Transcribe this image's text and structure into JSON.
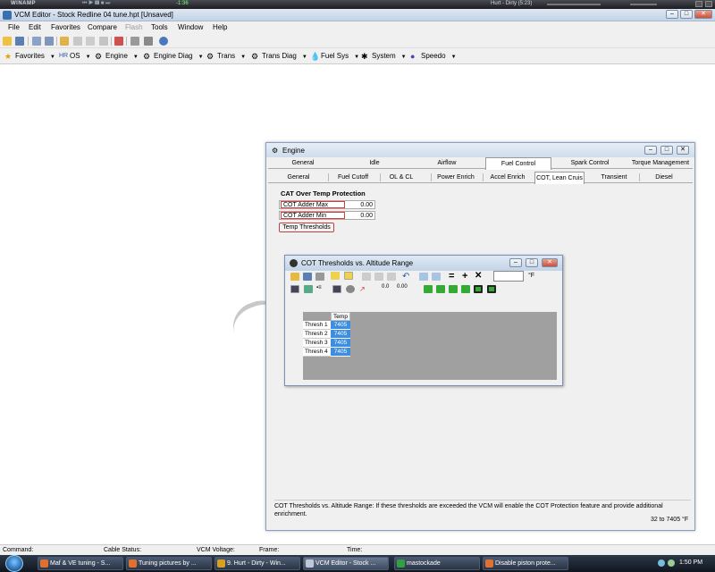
{
  "winamp": {
    "logo": "WINAMP",
    "time": "-1:36",
    "track": "Hurt - Dirty (5:23)"
  },
  "app": {
    "title": "VCM Editor - Stock Redline 04 tune.hpt   [Unsaved]"
  },
  "menu": {
    "items": [
      "File",
      "Edit",
      "Favorites",
      "Compare",
      "Flash",
      "Tools",
      "Window",
      "Help"
    ]
  },
  "toolbar2": {
    "items": [
      "Favorites",
      "OS",
      "Engine",
      "Engine Diag",
      "Trans",
      "Trans Diag",
      "Fuel Sys",
      "System",
      "Speedo"
    ]
  },
  "engine": {
    "title": "Engine",
    "tabs1": [
      "General",
      "Idle",
      "Airflow",
      "Fuel Control",
      "Spark Control",
      "Torque Management"
    ],
    "tabs2": [
      "General",
      "Fuel Cutoff",
      "OL & CL",
      "Power Enrich",
      "Accel Enrich",
      "COT, Lean Cruis",
      "Transient",
      "Diesel"
    ],
    "section_title": "CAT Over Temp Protection",
    "params": [
      {
        "label": "COT Adder Max",
        "value": "0.00"
      },
      {
        "label": "COT Adder Min",
        "value": "0.00"
      }
    ],
    "temp_button": "Temp Thresholds",
    "description": "COT Thresholds vs. Altitude Range: If these thresholds are exceeded the VCM will enable the COT Protection feature and provide additional enrichment.",
    "range": "32 to 7405 °F"
  },
  "cot": {
    "title": "COT Thresholds vs. Altitude Range",
    "unit": "°F",
    "zoom_a": "0.0",
    "zoom_b": "0.00",
    "col_header": "Temp",
    "rows": [
      {
        "label": "Thresh 1",
        "value": "7405"
      },
      {
        "label": "Thresh 2",
        "value": "7405"
      },
      {
        "label": "Thresh 3",
        "value": "7405"
      },
      {
        "label": "Thresh 4",
        "value": "7405"
      }
    ]
  },
  "statusbar": {
    "command": "Command:",
    "cable": "Cable Status:",
    "voltage": "VCM Voltage:",
    "frame": "Frame:",
    "time": "Time:"
  },
  "taskbar": {
    "buttons": [
      "Maf & VE tuning - S...",
      "Tuning pictures by ...",
      "9. Hurt - Dirty - Win...",
      "VCM Editor - Stock ...",
      "mastockade",
      "Disable piston prote..."
    ],
    "clock": "1:50 PM"
  }
}
